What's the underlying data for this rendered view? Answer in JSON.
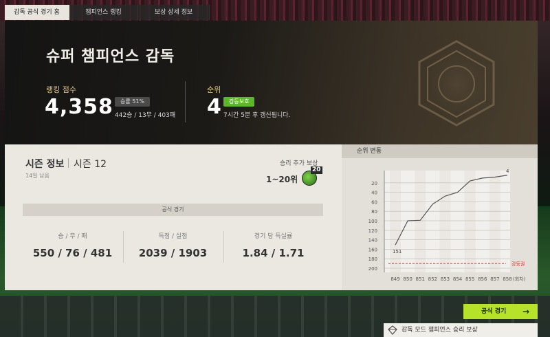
{
  "tabs": [
    {
      "label": "감독 공식 경기 홈",
      "active": true
    },
    {
      "label": "챔피언스 랭킹",
      "active": false
    },
    {
      "label": "보상 상세 정보",
      "active": false
    }
  ],
  "hero": {
    "title": "슈퍼 챔피언스 감독",
    "ranking_score_label": "랭킹 점수",
    "ranking_score": "4,358",
    "win_rate": "승률 51%",
    "record": "442승 / 13무 / 403패",
    "rank_label": "순위",
    "rank": "4",
    "status_badge": "강등보호",
    "update_text": "7시간 5분 후 갱신됩니다."
  },
  "season": {
    "title": "시즌 정보",
    "season_name": "시즌 12",
    "days_left": "14일 남음",
    "reward_label": "승리 추가 보상",
    "reward_range": "1~20위",
    "reward_count": "20",
    "section_label": "공식 경기",
    "stats": [
      {
        "label": "승 / 무 / 패",
        "value": "550 / 76 / 481"
      },
      {
        "label": "득점 / 실점",
        "value": "2039 / 1903"
      },
      {
        "label": "경기 당 득실률",
        "value": "1.84 / 1.71"
      }
    ]
  },
  "rank_chart": {
    "title": "순위 변동",
    "x_unit": "(회차)",
    "relegation_label": "강등권",
    "relegation_value": 190,
    "y_ticks": [
      20,
      40,
      60,
      80,
      100,
      120,
      140,
      160,
      180,
      200
    ],
    "first_label": "151",
    "last_label": "4"
  },
  "chart_data": {
    "type": "line",
    "title": "순위 변동",
    "x": [
      849,
      850,
      851,
      852,
      853,
      854,
      855,
      856,
      857,
      858
    ],
    "values": [
      151,
      100,
      99,
      65,
      48,
      40,
      16,
      10,
      8,
      4
    ],
    "ylim": [
      0,
      200
    ],
    "y_inverted": true,
    "grid": true,
    "reference_line": {
      "label": "강등권",
      "value": 190,
      "color": "#d9342b"
    }
  },
  "buttons": {
    "play": "공식 경기",
    "play_arrow": "→"
  },
  "bottom_reward": "감독 모드 챔피언스 승리 보상",
  "colors": {
    "accent_green": "#b6e32a",
    "badge_green": "#5cb82a",
    "gold_label": "#e2c48a",
    "relegation_red": "#d9342b"
  }
}
